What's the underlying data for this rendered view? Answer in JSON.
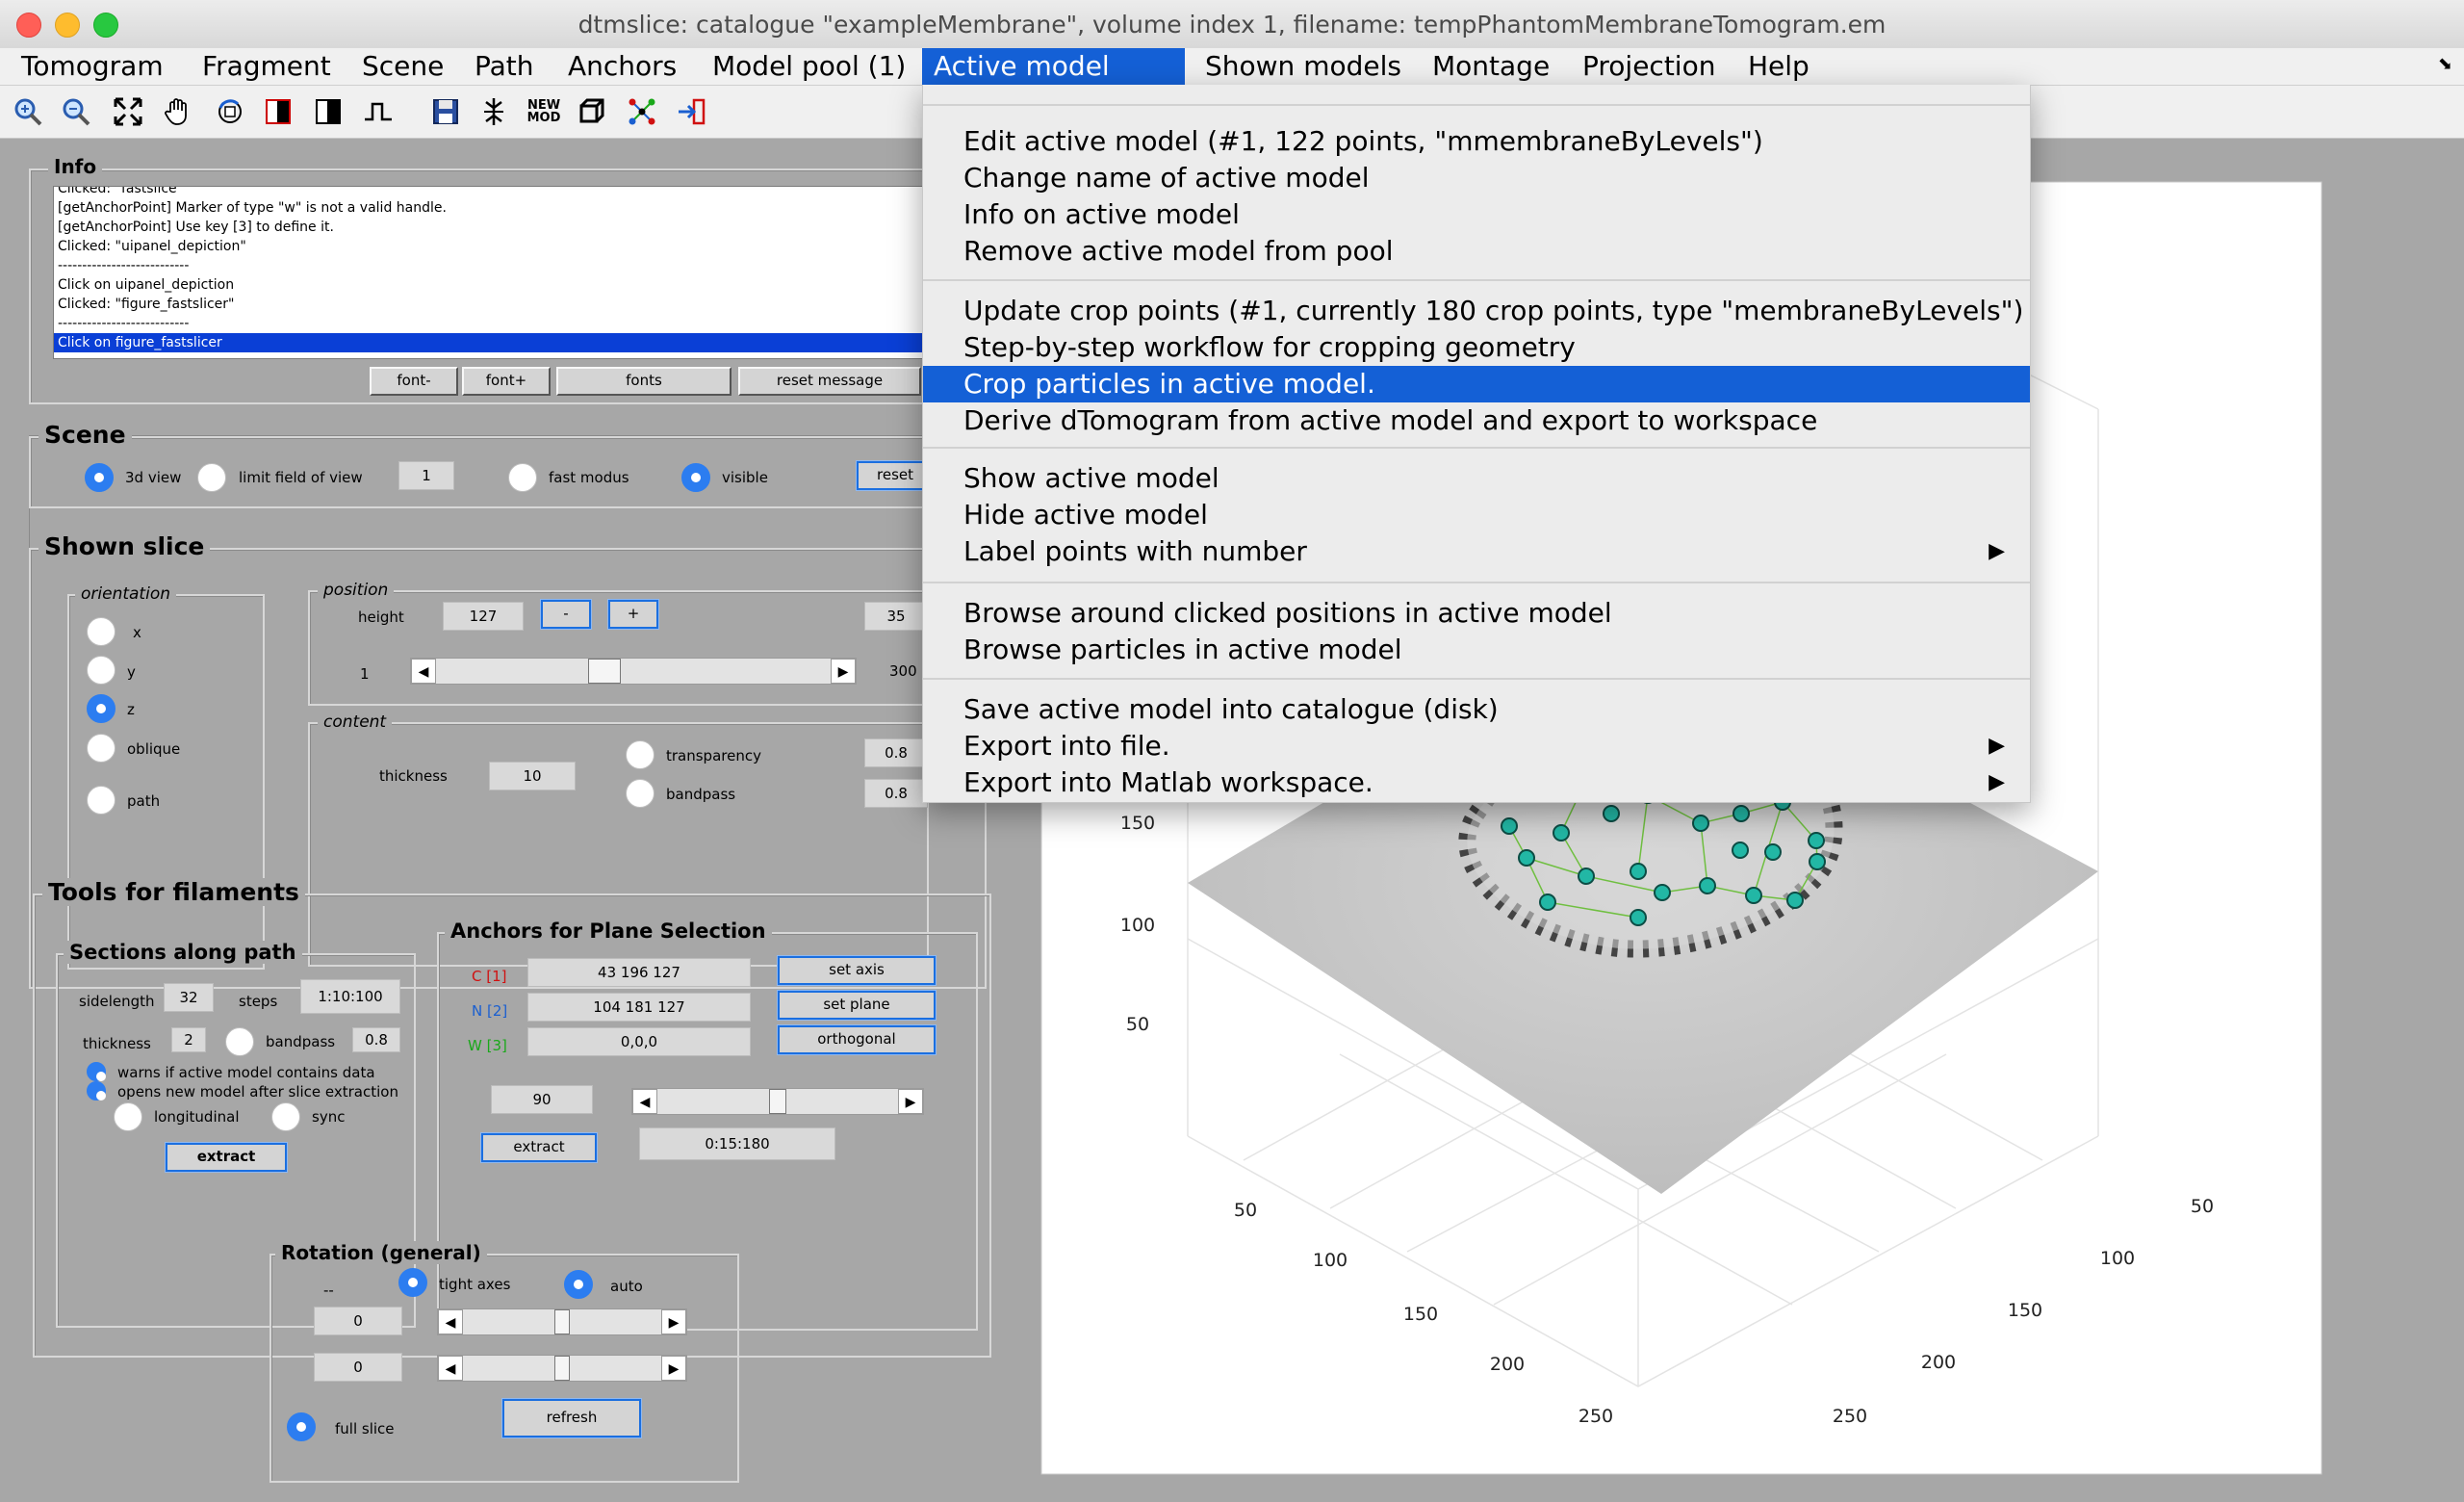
{
  "window": {
    "title": "dtmslice: catalogue \"exampleMembrane\", volume index 1, filename: tempPhantomMembraneTomogram.em"
  },
  "menubar": {
    "items": [
      "Tomogram",
      "Fragment",
      "Scene",
      "Path",
      "Anchors",
      "Model pool (1)",
      "Active model [#1]",
      "Shown models",
      "Montage",
      "Projection",
      "Help"
    ],
    "active_index": 6
  },
  "toolbar": {
    "icons": [
      "zoom-in-icon",
      "zoom-out-icon",
      "fit-icon",
      "pan-hand-icon",
      "rotate-3d-icon",
      "contrast-icon",
      "contrast-invert-icon",
      "pulse-icon",
      "save-icon",
      "split-icon",
      "new-model-icon",
      "cube-icon",
      "graph-icon",
      "export-arrow-icon"
    ],
    "new_mod_label": "NEW\nMOD"
  },
  "dropdown": {
    "groups": [
      [
        "Edit active model (#1, 122 points, \"mmembraneByLevels\")",
        "Change name of active model",
        "Info on active model",
        "Remove active model from pool"
      ],
      [
        "Update crop points (#1, currently 180 crop points, type \"membraneByLevels\")",
        "Step-by-step workflow for cropping geometry",
        "Crop particles in active model.",
        "Derive dTomogram from active model and export to workspace"
      ],
      [
        "Show active model",
        "Hide active model",
        "Label points with number"
      ],
      [
        "Browse around clicked positions in active model",
        "Browse particles in active model"
      ],
      [
        "Save active model into catalogue (disk)",
        "Export into file.",
        "Export into Matlab workspace."
      ]
    ],
    "highlighted": "Crop particles in active model.",
    "submenu_items": [
      "Label points with number",
      "Export into file.",
      "Export into Matlab workspace."
    ]
  },
  "info_panel": {
    "title": "Info",
    "log": [
      "Clicked: \"fastslice\"",
      "[getAnchorPoint] Marker of type \"w\" is not a valid handle.",
      "[getAnchorPoint] Use key [3] to define it.",
      "Clicked: \"uipanel_depiction\"",
      "---------------------------",
      "Click on uipanel_depiction",
      "Clicked: \"figure_fastslicer\"",
      "---------------------------",
      "Click on figure_fastslicer"
    ],
    "buttons": {
      "font_minus": "font-",
      "font_plus": "font+",
      "fonts": "fonts",
      "reset": "reset message"
    }
  },
  "scene_panel": {
    "title": "Scene",
    "view_3d": "3d view",
    "limit_fov": "limit field of view",
    "fov_value": "1",
    "fast_modus": "fast modus",
    "visible": "visible",
    "reset": "reset"
  },
  "shown_slice": {
    "title": "Shown slice",
    "orientation_title": "orientation",
    "orientations": [
      "x",
      "y",
      "z",
      "oblique",
      "path"
    ],
    "selected_orientation": "z",
    "position_title": "position",
    "height_label": "height",
    "height_value": "127",
    "minus": "-",
    "plus": "+",
    "max_value": "35",
    "slider_min": "1",
    "slider_max": "300",
    "slider_fraction": 0.42,
    "content_title": "content",
    "thickness_label": "thickness",
    "thickness_value": "10",
    "transparency_label": "transparency",
    "transparency_value": "0.8",
    "bandpass_label": "bandpass",
    "bandpass_value": "0.8"
  },
  "filaments": {
    "title": "Tools for filaments",
    "sections_title": "Sections along path",
    "sidelength_label": "sidelength",
    "sidelength_value": "32",
    "steps_label": "steps",
    "steps_value": "1:10:100",
    "thickness_label": "thickness",
    "thickness_value": "2",
    "bandpass_label": "bandpass",
    "bandpass_value": "0.8",
    "warn_label": "warns if active model contains data",
    "opens_label": "opens new model after slice extraction",
    "longitudinal_label": "longitudinal",
    "sync_label": "sync",
    "extract_label": "extract",
    "anchors_title": "Anchors for Plane Selection",
    "c_label": "C [1]",
    "c_value": "43 196 127",
    "n_label": "N [2]",
    "n_value": "104 181 127",
    "w_label": "W [3]",
    "w_value": "0,0,0",
    "set_axis": "set axis",
    "set_plane": "set plane",
    "orthogonal": "orthogonal",
    "angle_value": "90",
    "angle_slider_fraction": 0.5,
    "anchors_extract": "extract",
    "range_value": "0:15:180",
    "colors": {
      "c": "#d01010",
      "n": "#1a5fd0",
      "w": "#1aa81a"
    }
  },
  "rotation": {
    "title": "Rotation (general)",
    "dash": "--",
    "tight_axes": "tight axes",
    "auto": "auto",
    "value1": "0",
    "value2": "0",
    "slider1_fraction": 0.5,
    "slider2_fraction": 0.5,
    "full_slice": "full slice",
    "refresh": "refresh"
  },
  "plot": {
    "z_ticks": [
      "150",
      "100",
      "50"
    ],
    "x_ticks": [
      "50",
      "100",
      "150",
      "200",
      "250"
    ],
    "y_ticks": [
      "50",
      "100",
      "150",
      "200",
      "250"
    ]
  }
}
